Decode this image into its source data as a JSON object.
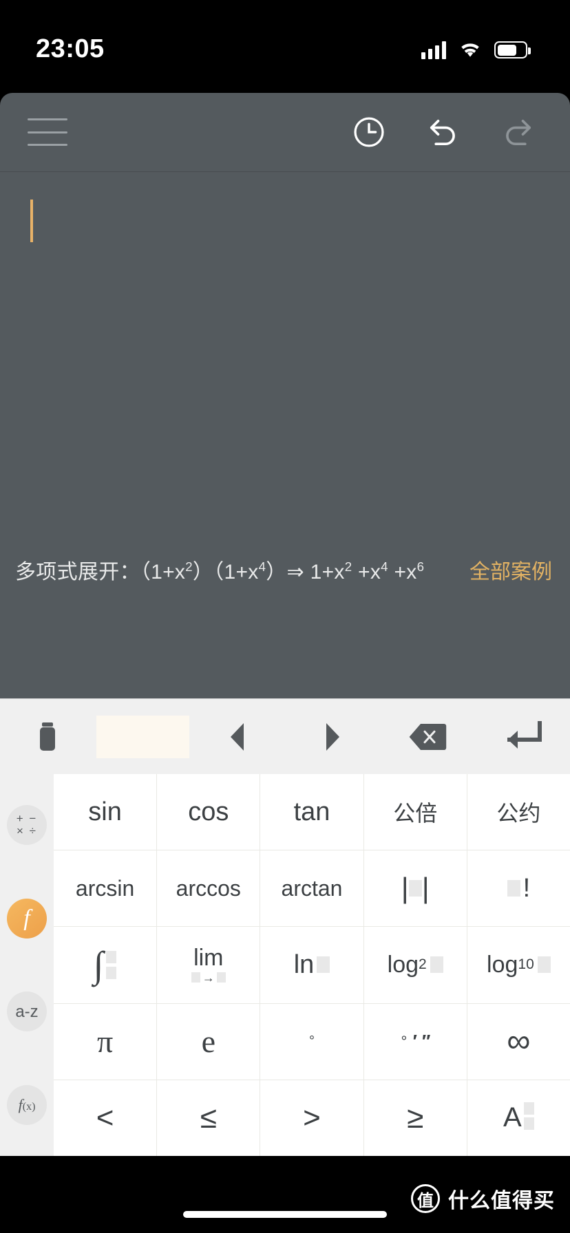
{
  "status_bar": {
    "time": "23:05",
    "icons": [
      "cellular-signal-icon",
      "wifi-icon",
      "battery-icon"
    ]
  },
  "toolbar": {
    "menu_label": "menu-icon",
    "history_label": "history-icon",
    "undo_label": "undo-icon",
    "redo_label": "redo-icon"
  },
  "editor": {
    "value": "",
    "caret_color": "#e8b268"
  },
  "hint": {
    "prefix": "多项式展开：（1+x",
    "full_text": "多项式展开：（1+x2）（1+x4）⇒ 1+x2 +x4 +x6",
    "parts": {
      "label": "多项式展开：",
      "expr_a": "（1+x",
      "sup_a": "2",
      "expr_b": "）（1+x",
      "sup_b": "4",
      "expr_c": "）⇒ 1+x",
      "sup_c": "2",
      "expr_d": " +x",
      "sup_d": "4",
      "expr_e": " +x",
      "sup_e": "6"
    },
    "link_label": "全部案例",
    "link_color": "#e2b263"
  },
  "action_bar": {
    "items": [
      {
        "name": "clear-all-button",
        "icon": "trash-icon",
        "label": ""
      },
      {
        "name": "space-button",
        "icon": "space-bar",
        "label": ""
      },
      {
        "name": "cursor-left-button",
        "icon": "triangle-left-icon",
        "label": ""
      },
      {
        "name": "cursor-right-button",
        "icon": "triangle-right-icon",
        "label": ""
      },
      {
        "name": "backspace-button",
        "icon": "backspace-icon",
        "label": ""
      },
      {
        "name": "enter-button",
        "icon": "enter-icon",
        "label": ""
      }
    ]
  },
  "categories": [
    {
      "id": "arithmetic",
      "label": "+ −\n× ÷",
      "active": false,
      "icon": "operators-icon"
    },
    {
      "id": "functions",
      "label": "f",
      "active": true,
      "icon": "function-icon"
    },
    {
      "id": "letters",
      "label": "a-z",
      "active": false,
      "icon": "alphabet-icon"
    },
    {
      "id": "fx",
      "label": "f(x)",
      "active": false,
      "icon": "fx-icon"
    }
  ],
  "keypad": {
    "rows": [
      [
        {
          "name": "key-sin",
          "label": "sin",
          "type": "text"
        },
        {
          "name": "key-cos",
          "label": "cos",
          "type": "text"
        },
        {
          "name": "key-tan",
          "label": "tan",
          "type": "text"
        },
        {
          "name": "key-lcm",
          "label": "公倍",
          "type": "cjk"
        },
        {
          "name": "key-gcd",
          "label": "公约",
          "type": "cjk"
        }
      ],
      [
        {
          "name": "key-arcsin",
          "label": "arcsin",
          "type": "text"
        },
        {
          "name": "key-arccos",
          "label": "arccos",
          "type": "text"
        },
        {
          "name": "key-arctan",
          "label": "arctan",
          "type": "text"
        },
        {
          "name": "key-absolute-value",
          "label": "|▢|",
          "type": "template"
        },
        {
          "name": "key-factorial",
          "label": "▢!",
          "type": "template"
        }
      ],
      [
        {
          "name": "key-integral",
          "label": "∫",
          "type": "template"
        },
        {
          "name": "key-limit",
          "label": "lim ▢→▢",
          "type": "template"
        },
        {
          "name": "key-natural-log",
          "label": "ln▢",
          "type": "template"
        },
        {
          "name": "key-log-base-2",
          "label": "log2▢",
          "type": "template"
        },
        {
          "name": "key-log-base-10",
          "label": "log10▢",
          "type": "template"
        }
      ],
      [
        {
          "name": "key-pi",
          "label": "π",
          "type": "text"
        },
        {
          "name": "key-euler-e",
          "label": "e",
          "type": "text"
        },
        {
          "name": "key-degree",
          "label": "°",
          "type": "text"
        },
        {
          "name": "key-deg-min-sec",
          "label": "° ′ ″",
          "type": "template"
        },
        {
          "name": "key-infinity",
          "label": "∞",
          "type": "text"
        }
      ],
      [
        {
          "name": "key-less-than",
          "label": "<",
          "type": "text"
        },
        {
          "name": "key-less-equal",
          "label": "≤",
          "type": "text"
        },
        {
          "name": "key-greater-than",
          "label": ">",
          "type": "text"
        },
        {
          "name": "key-greater-equal",
          "label": "≥",
          "type": "text"
        },
        {
          "name": "key-A-subscript",
          "label": "A▢",
          "type": "template"
        }
      ]
    ],
    "labels": {
      "sin": "sin",
      "cos": "cos",
      "tan": "tan",
      "lcm": "公倍",
      "gcd": "公约",
      "arcsin": "arcsin",
      "arccos": "arccos",
      "arctan": "arctan",
      "ln": "ln",
      "log2": "log",
      "log2_sub": "2",
      "log10": "log",
      "log10_sub": "10",
      "lim": "lim",
      "pi": "π",
      "e": "e",
      "degree": "°",
      "infinity": "∞",
      "lt": "<",
      "le": "≤",
      "gt": ">",
      "ge": "≥",
      "A": "A",
      "factorial": "!",
      "minute": "′",
      "second": "″",
      "integral": "∫"
    }
  },
  "watermark": {
    "logo_char": "值",
    "text": "什么值得买"
  }
}
